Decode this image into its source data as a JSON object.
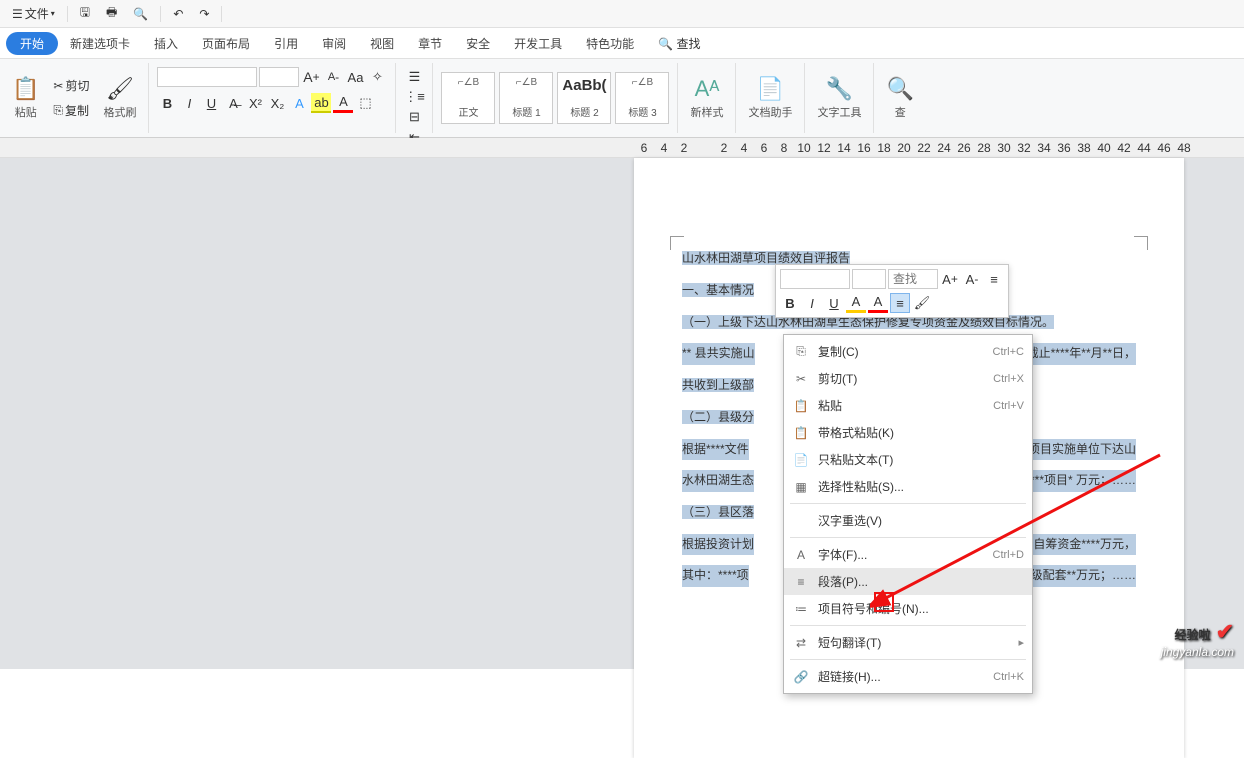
{
  "titlebar": {
    "menu": "文件",
    "undo": "↶",
    "redo": "↷"
  },
  "menubar": {
    "tabs": [
      "开始",
      "新建选项卡",
      "插入",
      "页面布局",
      "引用",
      "审阅",
      "视图",
      "章节",
      "安全",
      "开发工具",
      "特色功能"
    ],
    "search": "查找"
  },
  "ribbon": {
    "clipboard": {
      "paste": "粘贴",
      "cut": "剪切",
      "copy": "复制",
      "brush": "格式刷"
    },
    "font": {
      "name": "",
      "size": "",
      "grow": "A",
      "shrink": "A",
      "clear": "Aa"
    },
    "btns": {
      "b": "B",
      "i": "I",
      "u": "U",
      "s": "A",
      "x2": "X²",
      "x1": "X₂",
      "a1": "A",
      "a2": "A",
      "a3": "A"
    },
    "styles": [
      {
        "prev": "⌐∠B",
        "name": "正文"
      },
      {
        "prev": "⌐∠B",
        "name": "标题 1"
      },
      {
        "prev": "AaBb(",
        "name": "标题 2"
      },
      {
        "prev": "⌐∠B",
        "name": "标题 3"
      }
    ],
    "newstyle": "新样式",
    "dochelper": "文档助手",
    "texttool": "文字工具",
    "find": "查"
  },
  "ruler": [
    "6",
    "4",
    "2",
    "",
    "2",
    "4",
    "6",
    "8",
    "10",
    "12",
    "14",
    "16",
    "18",
    "20",
    "22",
    "24",
    "26",
    "28",
    "30",
    "32",
    "34",
    "36",
    "38",
    "40",
    "42",
    "44",
    "46",
    "48"
  ],
  "doc": {
    "l0": "山水林田湖草项目绩效自评报告",
    "l1": "一、基本情况",
    "l2": "（一）上级下达山水林田湖草生态保护修复专项资金及绩效目标情况。",
    "l3a": "** 县共实施山",
    "l3b": "元。截止****年**月**日，",
    "l4": "共收到上级部",
    "l5": "（二）县级分",
    "l6a": "根据****文件",
    "l6b": "已向各项目实施单位下达山",
    "l7a": "水林田湖生态",
    "l7b": "****项目* 万元；……",
    "l8": "（三）县区落",
    "l9a": "根据投资计划",
    "l9b": "项目及自筹资金****万元，",
    "l10a": "其中：****项",
    "l10b": "项目县级配套**万元；……"
  },
  "floatbar": {
    "fontname": "",
    "size": "",
    "find_ph": "查找"
  },
  "ctx": [
    {
      "ico": "⎘",
      "lbl": "复制(C)",
      "sc": "Ctrl+C"
    },
    {
      "ico": "✂",
      "lbl": "剪切(T)",
      "sc": "Ctrl+X"
    },
    {
      "ico": "📋",
      "lbl": "粘贴",
      "sc": "Ctrl+V"
    },
    {
      "ico": "📋",
      "lbl": "带格式粘贴(K)",
      "sc": ""
    },
    {
      "ico": "📄",
      "lbl": "只粘贴文本(T)",
      "sc": "",
      "dis": true
    },
    {
      "ico": "▦",
      "lbl": "选择性粘贴(S)...",
      "sc": ""
    },
    {
      "ico": "",
      "lbl": "汉字重选(V)",
      "sc": ""
    },
    {
      "ico": "A",
      "lbl": "字体(F)...",
      "sc": "Ctrl+D"
    },
    {
      "ico": "≡",
      "lbl": "段落(P)...",
      "sc": "",
      "hov": true
    },
    {
      "ico": "≔",
      "lbl": "项目符号和编号(N)...",
      "sc": ""
    },
    {
      "ico": "⇄",
      "lbl": "短句翻译(T)",
      "sc": "",
      "arrow": true
    },
    {
      "ico": "🔗",
      "lbl": "超链接(H)...",
      "sc": "Ctrl+K"
    }
  ],
  "watermark": {
    "t1": "经验啦",
    "t2": "jingyanla.com"
  }
}
